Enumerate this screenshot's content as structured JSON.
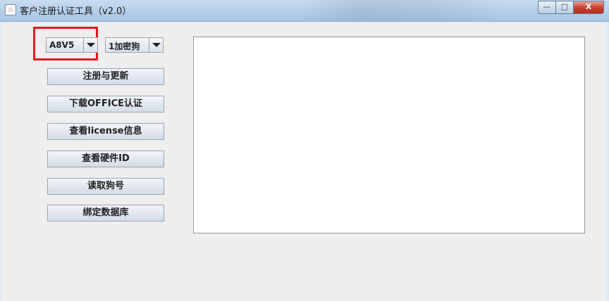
{
  "window": {
    "title": "客户注册认证工具（v2.0）",
    "minimize_label": "—",
    "maximize_label": "□",
    "close_label": "X"
  },
  "controls": {
    "version_select": {
      "value": "A8V5"
    },
    "dongle_select": {
      "value": "1加密狗"
    }
  },
  "buttons": [
    {
      "label": "注册与更新"
    },
    {
      "label": "下载OFFICE认证"
    },
    {
      "label": "查看license信息"
    },
    {
      "label": "查看硬件ID"
    },
    {
      "label": "读取狗号"
    },
    {
      "label": "绑定数据库"
    }
  ],
  "output": {
    "text": ""
  },
  "colors": {
    "highlight": "#e21b1b",
    "close_button": "#c7402a"
  }
}
